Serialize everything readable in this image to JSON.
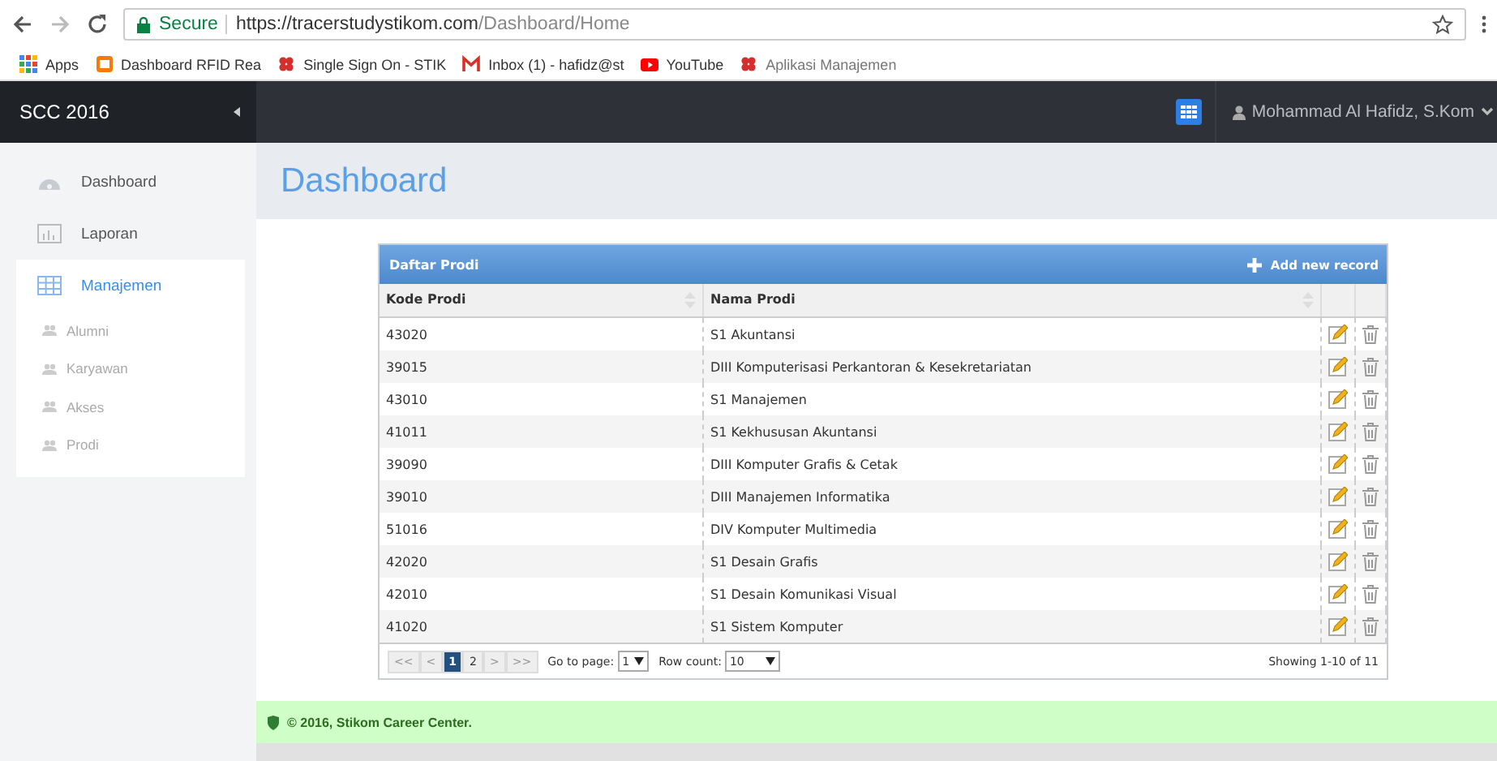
{
  "browser": {
    "secure_label": "Secure",
    "url_host": "https://tracerstudystikom.com",
    "url_path": "/Dashboard/Home",
    "bookmarks": [
      {
        "label": "Apps",
        "kind": "apps"
      },
      {
        "label": "Dashboard RFID Rea",
        "kind": "orange"
      },
      {
        "label": "Single Sign On - STIK",
        "kind": "red"
      },
      {
        "label": "Inbox (1) - hafidz@st",
        "kind": "mail"
      },
      {
        "label": "YouTube",
        "kind": "youtube"
      },
      {
        "label": "Aplikasi Manajemen",
        "kind": "red"
      }
    ]
  },
  "topbar": {
    "brand": "SCC 2016",
    "user": "Mohammad Al Hafidz, S.Kom"
  },
  "sidebar": {
    "items": [
      {
        "label": "Dashboard",
        "kind": "gauge",
        "selected": false
      },
      {
        "label": "Laporan",
        "kind": "chart",
        "selected": false
      },
      {
        "label": "Manajemen",
        "kind": "grid",
        "selected": true,
        "children": [
          {
            "label": "Alumni"
          },
          {
            "label": "Karyawan"
          },
          {
            "label": "Akses"
          },
          {
            "label": "Prodi"
          }
        ]
      }
    ]
  },
  "page_title": "Dashboard",
  "table": {
    "title": "Daftar Prodi",
    "add_label": "Add new record",
    "columns": [
      "Kode Prodi",
      "Nama Prodi"
    ],
    "rows": [
      [
        "43020",
        "S1 Akuntansi"
      ],
      [
        "39015",
        "DIII Komputerisasi Perkantoran & Kesekretariatan"
      ],
      [
        "43010",
        "S1 Manajemen"
      ],
      [
        "41011",
        "S1 Kekhususan Akuntansi"
      ],
      [
        "39090",
        "DIII Komputer Grafis & Cetak"
      ],
      [
        "39010",
        "DIII Manajemen Informatika"
      ],
      [
        "51016",
        "DIV Komputer Multimedia"
      ],
      [
        "42020",
        "S1 Desain Grafis"
      ],
      [
        "42010",
        "S1 Desain Komunikasi Visual"
      ],
      [
        "41020",
        "S1 Sistem Komputer"
      ]
    ],
    "pager": {
      "buttons": [
        {
          "label": "<<",
          "kind": "nav"
        },
        {
          "label": "<",
          "kind": "nav"
        },
        {
          "label": "1",
          "kind": "page",
          "selected": true
        },
        {
          "label": "2",
          "kind": "page",
          "selected": false
        },
        {
          "label": ">",
          "kind": "nav"
        },
        {
          "label": ">>",
          "kind": "nav"
        }
      ],
      "goto_label": "Go to page:",
      "goto_value": "1",
      "rowcount_label": "Row count:",
      "rowcount_value": "10",
      "summary": "Showing 1-10 of 11"
    }
  },
  "footer": "© 2016, Stikom Career Center."
}
